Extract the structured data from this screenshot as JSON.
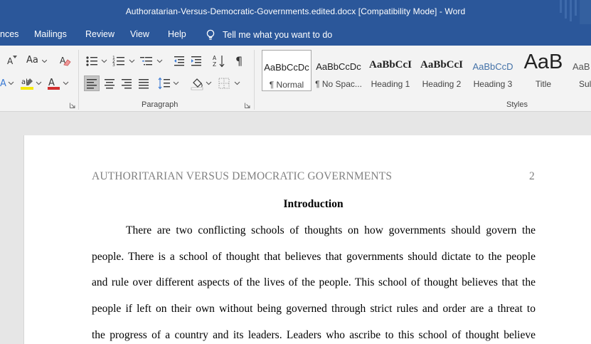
{
  "window": {
    "title": "Authoratarian-Versus-Democratic-Governments.edited.docx [Compatibility Mode]  -  Word"
  },
  "tabs": {
    "items": [
      {
        "label": "nces"
      },
      {
        "label": "Mailings"
      },
      {
        "label": "Review"
      },
      {
        "label": "View"
      },
      {
        "label": "Help"
      }
    ],
    "tell_me": "Tell me what you want to do"
  },
  "ribbon": {
    "font_group": {
      "grow_font_glyph": "A",
      "change_case_glyph": "Aa",
      "font_color_glyph": "A",
      "colors": {
        "highlight": "#f5e90b",
        "font_color": "#d22f2f"
      }
    },
    "paragraph_group": {
      "label": "Paragraph",
      "pilcrow_glyph": "¶"
    },
    "styles_group": {
      "label": "Styles",
      "items": [
        {
          "sample": "AaBbCcDc",
          "name": "¶ Normal",
          "selected": true
        },
        {
          "sample": "AaBbCcDc",
          "name": "¶ No Spac...",
          "selected": false
        },
        {
          "sample": "AaBbCcI",
          "name": "Heading 1",
          "selected": false
        },
        {
          "sample": "AaBbCcI",
          "name": "Heading 2",
          "selected": false
        },
        {
          "sample": "AaBbCcD",
          "name": "Heading 3",
          "selected": false
        },
        {
          "sample": "AaB",
          "name": "Title",
          "selected": false
        },
        {
          "sample": "AaB",
          "name": "Sul",
          "selected": false
        }
      ]
    }
  },
  "document": {
    "header": "AUTHORITARIAN VERSUS DEMOCRATIC GOVERNMENTS",
    "page_number": "2",
    "heading": "Introduction",
    "lines": [
      "There are two conflicting schools of thoughts on how governments should govern the",
      "people. There is a school of thought that believes that governments should dictate to the people",
      "and rule over different aspects of the lives of the people. This school of thought believes that the",
      "people if left on their own without being governed through strict rules and order are a threat to",
      "the progress of a country and its leaders. Leaders who ascribe to this school of thought believe"
    ]
  }
}
